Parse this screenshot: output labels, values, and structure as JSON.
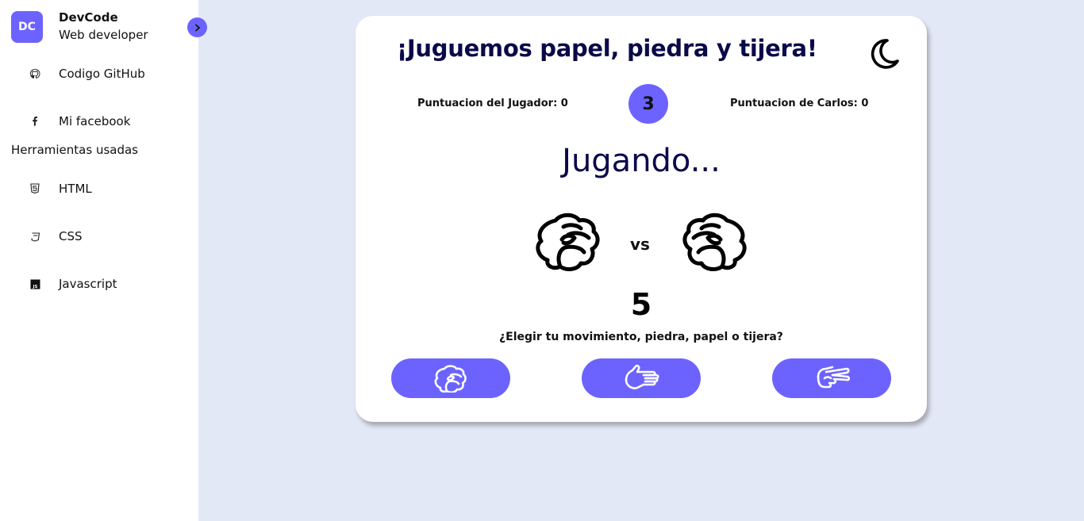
{
  "profile": {
    "initials": "DC",
    "name": "DevCode",
    "role": "Web developer"
  },
  "sidebar": {
    "links": [
      {
        "label": "Codigo GitHub",
        "icon": "github-icon"
      },
      {
        "label": "Mi facebook",
        "icon": "facebook-icon"
      }
    ],
    "tools_title": "Herramientas usadas",
    "tools": [
      {
        "label": "HTML",
        "icon": "html5-icon"
      },
      {
        "label": "CSS",
        "icon": "css3-icon"
      },
      {
        "label": "Javascript",
        "icon": "javascript-icon"
      }
    ]
  },
  "game": {
    "title": "¡Juguemos papel, piedra y tijera!",
    "player_score": "Puntuacion del Jugador: 0",
    "carlos_score": "Puntuacion de Carlos: 0",
    "round": "3",
    "status": "Jugando...",
    "vs": "vs",
    "countdown": "5",
    "prompt": "¿Elegir tu movimiento, piedra, papel o tijera?",
    "choices": [
      {
        "name": "piedra",
        "icon": "rock-hand-icon"
      },
      {
        "name": "papel",
        "icon": "paper-hand-icon"
      },
      {
        "name": "tijera",
        "icon": "scissors-hand-icon"
      }
    ]
  },
  "colors": {
    "accent": "#6c63ff",
    "background": "#e3e8f6",
    "title": "#0a0a4a"
  }
}
